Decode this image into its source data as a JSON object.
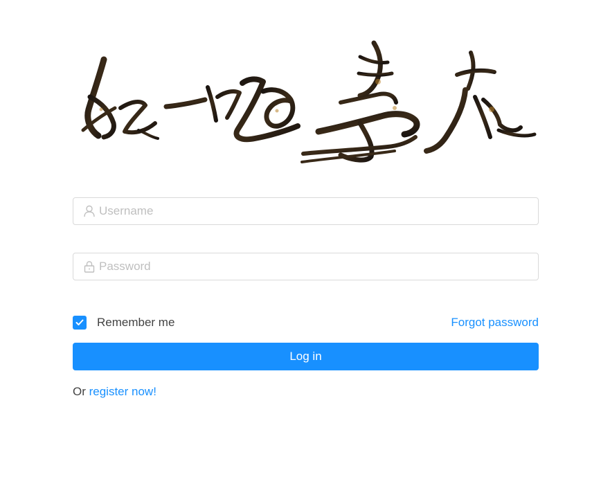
{
  "logo": {
    "icon": "calligraphy-logo-icon",
    "stroke_color": "#1a1410",
    "accent_color": "#b8822a"
  },
  "form": {
    "username": {
      "placeholder": "Username",
      "value": "",
      "icon": "user-icon"
    },
    "password": {
      "placeholder": "Password",
      "value": "",
      "icon": "lock-icon"
    },
    "remember": {
      "label": "Remember me",
      "checked": true,
      "icon": "check-icon"
    },
    "forgot_label": "Forgot password",
    "login_label": "Log in",
    "register_prefix": "Or",
    "register_link": "register now!"
  },
  "colors": {
    "primary": "#1890ff",
    "border": "#d9d9d9",
    "placeholder": "#bfbfbf"
  }
}
